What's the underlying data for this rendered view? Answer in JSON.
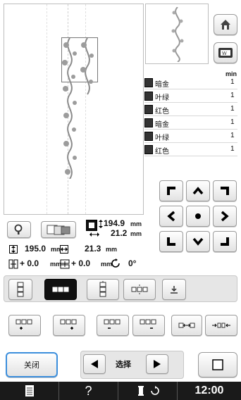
{
  "header": {
    "min_label": "min"
  },
  "threads": [
    {
      "name": "暗金",
      "count": "1"
    },
    {
      "name": "叶绿",
      "count": "1"
    },
    {
      "name": "红色",
      "count": "1"
    },
    {
      "name": "暗金",
      "count": "1"
    },
    {
      "name": "叶绿",
      "count": "1"
    },
    {
      "name": "红色",
      "count": "1"
    }
  ],
  "size": {
    "height_value": "194.9",
    "width_value": "21.2",
    "unit": "mm"
  },
  "info": {
    "total_height": "195.0",
    "total_width": "21.3",
    "offset_x": "+ 0.0",
    "offset_y": "+ 0.0",
    "angle": "0°",
    "unit": "mm"
  },
  "footer": {
    "close_label": "关闭",
    "select_label": "选择"
  },
  "taskbar": {
    "help": "?",
    "time": "12:00"
  }
}
